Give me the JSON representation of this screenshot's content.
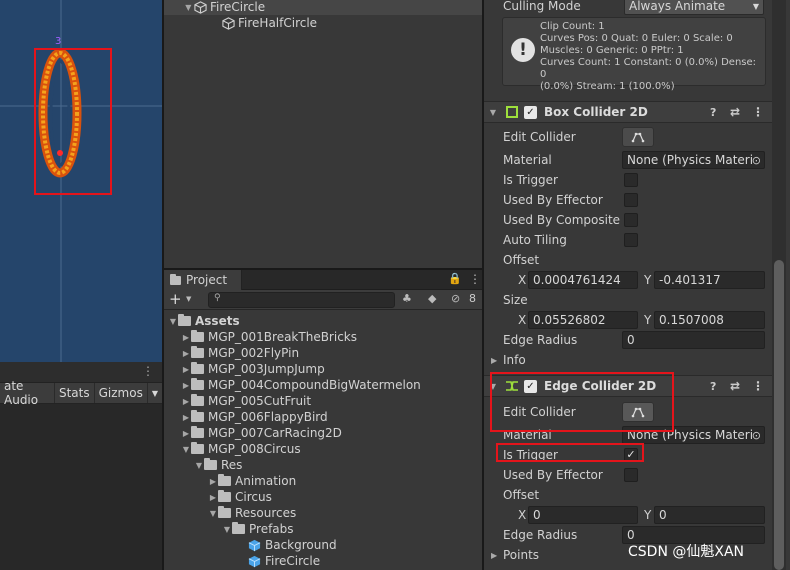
{
  "scene": {},
  "game_toolbar": {
    "audio_label": "ate Audio",
    "stats_label": "Stats",
    "gizmos_label": "Gizmos"
  },
  "hierarchy": {
    "items": [
      {
        "label": "FireCircle"
      },
      {
        "label": "FireHalfCircle"
      }
    ]
  },
  "project": {
    "tab_label": "Project",
    "hidden_count": "8",
    "tree": [
      {
        "label": "Assets"
      },
      {
        "label": "MGP_001BreakTheBricks"
      },
      {
        "label": "MGP_002FlyPin"
      },
      {
        "label": "MGP_003JumpJump"
      },
      {
        "label": "MGP_004CompoundBigWatermelon"
      },
      {
        "label": "MGP_005CutFruit"
      },
      {
        "label": "MGP_006FlappyBird"
      },
      {
        "label": "MGP_007CarRacing2D"
      },
      {
        "label": "MGP_008Circus"
      },
      {
        "label": "Res"
      },
      {
        "label": "Animation"
      },
      {
        "label": "Circus"
      },
      {
        "label": "Resources"
      },
      {
        "label": "Prefabs"
      },
      {
        "label": "Background"
      },
      {
        "label": "FireCircle"
      }
    ]
  },
  "inspector": {
    "culling_mode_label": "Culling Mode",
    "culling_mode_value": "Always Animate",
    "info_lines": [
      "Clip Count: 1",
      "Curves Pos: 0 Quat: 0 Euler: 0 Scale: 0",
      "Muscles: 0 Generic: 0 PPtr: 1",
      "Curves Count: 1 Constant: 0 (0.0%) Dense: 0",
      "(0.0%) Stream: 1 (100.0%)"
    ],
    "box_collider": {
      "title": "Box Collider 2D",
      "edit_collider": "Edit Collider",
      "material_label": "Material",
      "material_value": "None (Physics Materi",
      "is_trigger": "Is Trigger",
      "used_by_effector": "Used By Effector",
      "used_by_composite": "Used By Composite",
      "auto_tiling": "Auto Tiling",
      "offset_label": "Offset",
      "offset_x": "0.0004761424",
      "offset_y": "-0.401317",
      "size_label": "Size",
      "size_x": "0.05526802",
      "size_y": "0.1507008",
      "edge_radius_label": "Edge Radius",
      "edge_radius_value": "0",
      "info_label": "Info"
    },
    "edge_collider": {
      "title": "Edge Collider 2D",
      "edit_collider": "Edit Collider",
      "material_label": "Material",
      "material_value": "None (Physics Materi",
      "is_trigger": "Is Trigger",
      "is_trigger_checked": true,
      "used_by_effector": "Used By Effector",
      "offset_label": "Offset",
      "offset_x": "0",
      "offset_y": "0",
      "edge_radius_label": "Edge Radius",
      "edge_radius_value": "0",
      "points_label": "Points"
    },
    "axis_x": "X",
    "axis_y": "Y"
  },
  "watermark": "CSDN @仙魁XAN",
  "colors": {
    "highlight_red": "#e5141b",
    "box_icon": "#9ee03c",
    "edge_icon": "#9ee03c",
    "scene_bg": "#25456b"
  }
}
